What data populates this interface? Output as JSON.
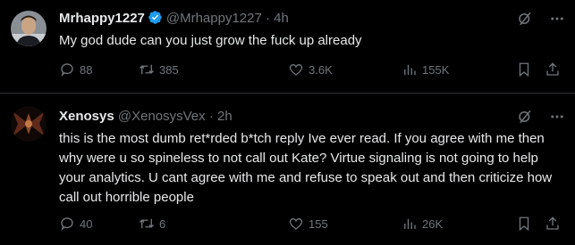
{
  "tweets": [
    {
      "name": "Mrhappy1227",
      "handle": "@Mrhappy1227",
      "time": "· 4h",
      "text": "My god dude can you just grow the fuck up already",
      "replies": "88",
      "retweets": "385",
      "likes": "3.6K",
      "views": "155K",
      "verified": true,
      "colors": {
        "verified": "#1d9bf0"
      }
    },
    {
      "name": "Xenosys",
      "handle": "@XenosysVex",
      "time": "· 2h",
      "text": "this is the most dumb ret*rded b*tch reply Ive ever read. If you agree with me then why were u so spineless to not call out Kate? Virtue signaling is not going to help your analytics. U cant agree with me and refuse to speak out and then criticize how call out horrible people",
      "replies": "40",
      "retweets": "6",
      "likes": "155",
      "views": "26K",
      "verified": false
    }
  ],
  "icons": [
    "reply-icon",
    "retweet-icon",
    "like-icon",
    "views-icon",
    "bookmark-icon",
    "share-icon",
    "grok-icon",
    "more-icon"
  ]
}
